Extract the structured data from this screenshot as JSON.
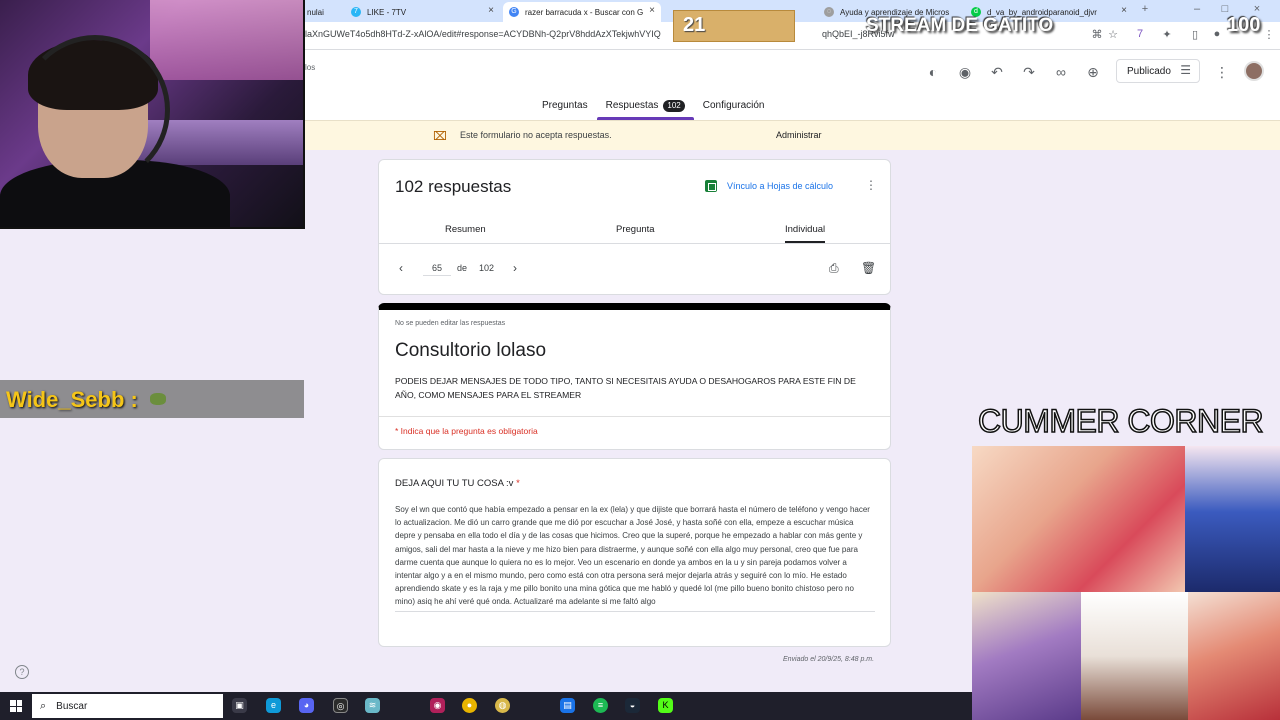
{
  "browser": {
    "tabs": [
      {
        "label": "LIKE - 7TV"
      },
      {
        "label": "razer barracuda x - Buscar con G"
      },
      {
        "label": "Ayuda y aprendizaje de Micros"
      },
      {
        "label": "d_va_by_androidparanoid_djvr"
      }
    ],
    "tab_partial": "nulai",
    "url": "laXnGUWeT4o5dh8HTd-Z-xAlOA/edit#response=ACYDBNh-Q2prV8hddAzXTekjwhVYIQ",
    "url_tail": "qhQbEI_-j8Rvi5fw"
  },
  "forms": {
    "breadcrumb": "los",
    "publish_label": "Publicado",
    "tabs": [
      {
        "label": "Preguntas"
      },
      {
        "label": "Respuestas",
        "badge": "102"
      },
      {
        "label": "Configuración"
      }
    ],
    "banner_text": "Este formulario no acepta respuestas.",
    "banner_action": "Administrar",
    "summary": {
      "count_title": "102 respuestas",
      "sheets_link": "Vínculo a Hojas de cálculo",
      "view_tabs": [
        "Resumen",
        "Pregunta",
        "Individual"
      ],
      "current": "65",
      "of": "de",
      "total": "102"
    },
    "form": {
      "no_edit": "No se pueden editar las respuestas",
      "title": "Consultorio lolaso",
      "description": "PODEIS DEJAR MENSAJES DE TODO TIPO, TANTO SI NECESITAIS AYUDA O DESAHOGAROS PARA ESTE FIN DE AÑO, COMO MENSAJES PARA EL STREAMER",
      "required_note": "* Indica que la pregunta es obligatoria"
    },
    "question": {
      "title": "DEJA AQUI TU TU COSA :v",
      "required_mark": " *",
      "answer": "Soy el wn que contó que había empezado a pensar en la ex (lela) y que dijiste que borrará hasta el número de teléfono y vengo hacer lo actualizacion. Me dió un carro grande que me dió por escuchar a José José, y hasta soñé con ella, empeze a escuchar música depre y pensaba en ella todo el día y de las cosas que hicimos. Creo que la superé, porque he empezado a hablar con más gente y amigos, sali del mar hasta a la nieve y me hizo bien para distraerme, y aunque soñé con ella algo muy personal, creo que fue para darme cuenta que aunque lo quiera no es lo mejor. Veo un escenario en donde ya ambos en la u y sin pareja podamos volver a intentar algo y a en el mismo mundo, pero como está con otra persona será mejor dejarla atrás y seguiré con lo mío. He estado aprendiendo skate y es la raja y me pillo bonito una mina gótica que me habló y quedé lol (me pillo bueno bonito chistoso pero no mino) asiq he ahí veré qué onda. Actualizaré ma adelante si me faltó algo"
    },
    "sent_label": "Enviado el 20/9/25, 8:48 p.m."
  },
  "overlay": {
    "chat_user": "Wide_Sebb",
    "chat_sep": ":",
    "counter_left": "21",
    "stream_title": "STREAM DE GATITO",
    "counter_right": "100",
    "corner_title": "CUMMER CORNER"
  },
  "taskbar": {
    "search_label": "Buscar"
  },
  "colors": {
    "accent_purple": "#673ab7",
    "required_red": "#d93025",
    "link_blue": "#1a73e8",
    "banner_bg": "#fef7e0"
  }
}
